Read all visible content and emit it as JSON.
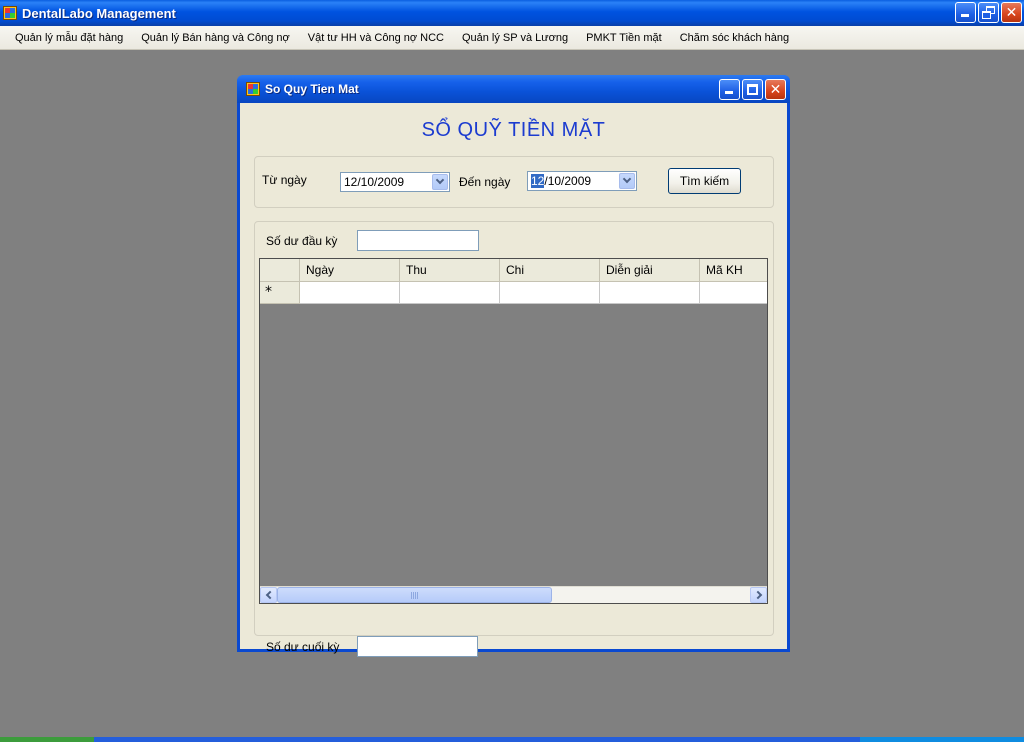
{
  "app": {
    "title": "DentalLabo Management"
  },
  "menu": {
    "items": [
      "Quản lý mẫu đặt hàng",
      "Quản lý Bán hàng và Công nợ",
      "Vật tư HH và Công nợ NCC",
      "Quản lý SP và Lương",
      "PMKT Tiền mặt",
      "Chăm sóc khách hàng"
    ]
  },
  "child": {
    "title": "So Quy Tien Mat",
    "heading": "SỔ QUỸ TIỀN MẶT",
    "filter": {
      "from_label": "Từ ngày",
      "from_value": "12/10/2009",
      "to_label": "Đến ngày",
      "to_value_selected": "12",
      "to_value_rest": "/10/2009",
      "search_button": "Tìm kiếm"
    },
    "opening_balance_label": "Số dư đầu kỳ",
    "opening_balance_value": "",
    "closing_balance_label": "Số dư cuối kỳ",
    "closing_balance_value": "",
    "grid": {
      "columns": [
        "Ngày",
        "Thu",
        "Chi",
        "Diễn giải",
        "Mã KH"
      ],
      "new_row_marker": "*"
    }
  },
  "colors": {
    "heading": "#1c3cd0",
    "titlebar": "#0053e0",
    "desktop": "#808080"
  },
  "icons": [
    "app-icon",
    "minimize-icon",
    "restore-icon",
    "maximize-icon",
    "close-icon",
    "chevron-down-icon",
    "scroll-left-icon",
    "scroll-right-icon"
  ]
}
